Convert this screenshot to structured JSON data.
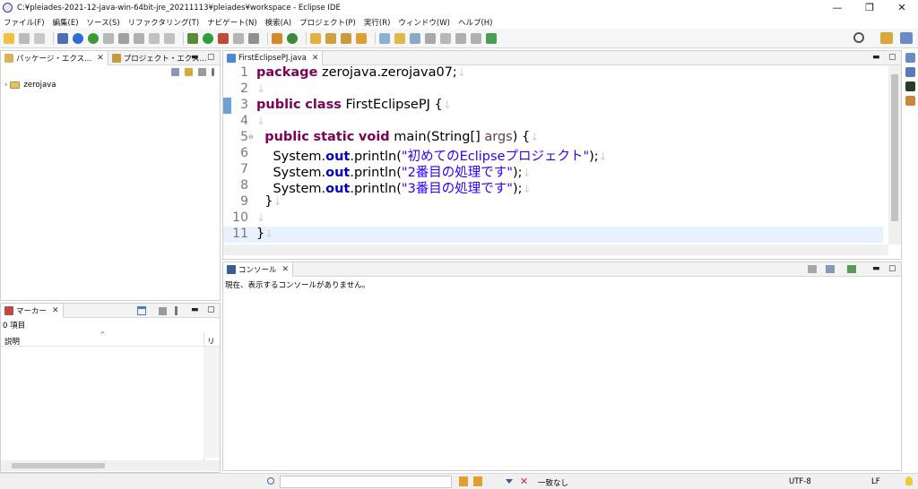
{
  "window": {
    "title": "C:¥pleiades-2021-12-java-win-64bit-jre_20211113¥pleiades¥workspace - Eclipse IDE",
    "minimize": "—",
    "maximize": "❐",
    "close": "✕"
  },
  "menu": [
    "ファイル(F)",
    "編集(E)",
    "ソース(S)",
    "リファクタリング(T)",
    "ナビゲート(N)",
    "検索(A)",
    "プロジェクト(P)",
    "実行(R)",
    "ウィンドウ(W)",
    "ヘルプ(H)"
  ],
  "left_panel": {
    "tabs": [
      {
        "label": "パッケージ・エクス...",
        "close": "✕"
      },
      {
        "label": "プロジェクト・エクス..."
      }
    ],
    "tree": [
      {
        "label": "zerojava",
        "chevron": "›"
      }
    ]
  },
  "markers_panel": {
    "tab": "マーカー",
    "close": "✕",
    "count": "0 項目",
    "columns": [
      "説明",
      "リソ-"
    ],
    "sort_indicator": "^"
  },
  "editor": {
    "tab": "FirstEclipsePJ.java",
    "close": "✕",
    "fold_marker": "⊖",
    "line_numbers": [
      "1",
      "2",
      "3",
      "4",
      "5",
      "6",
      "7",
      "8",
      "9",
      "10",
      "11"
    ],
    "tokens": {
      "package_kw": "package",
      "package_name": " zerojava.zerojava07;",
      "public": "public",
      "class": "class",
      "class_name": " FirstEclipsePJ {",
      "static": "static",
      "void": "void",
      "main_sig": " main(String[] ",
      "args": "args",
      "main_end": ") {",
      "system": "System.",
      "out": "out",
      "println_open": ".println(",
      "str1": "\"初めてのEclipseプロジェクト\"",
      "str2": "\"2番目の処理です\"",
      "str3": "\"3番目の処理です\"",
      "stmt_end": ");",
      "close_inner": "}",
      "close_outer": "}",
      "return_glyph": "↓"
    }
  },
  "console": {
    "tab": "コンソール",
    "close": "✕",
    "message": "現在、表示するコンソールがありません。"
  },
  "status_bar": {
    "match": "一致なし",
    "encoding": "UTF-8",
    "line_ending": "LF"
  },
  "colors": {
    "keyword": "#7f0055",
    "field": "#0000c0",
    "string": "#2a00ff",
    "parameter": "#6a3e3e",
    "marker_bar": "#6fa0d6",
    "highlight_line": "#e8f2fe"
  }
}
